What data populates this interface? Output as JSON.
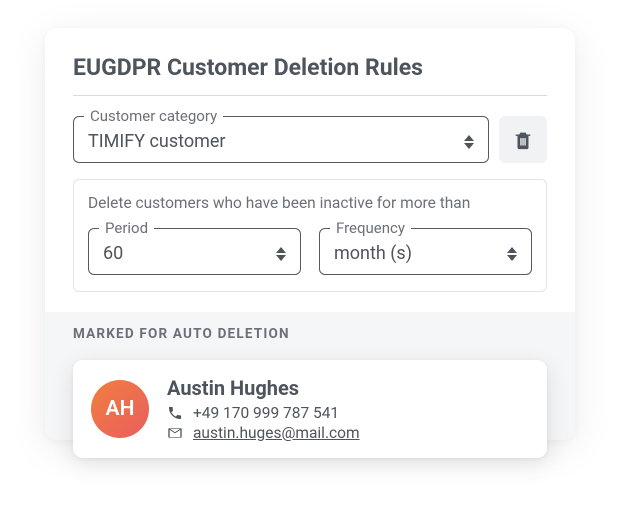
{
  "title": "EUGDPR Customer Deletion Rules",
  "category": {
    "label": "Customer category",
    "value": "TIMIFY customer"
  },
  "rule": {
    "description": "Delete customers who have been inactive for more than",
    "period": {
      "label": "Period",
      "value": "60"
    },
    "frequency": {
      "label": "Frequency",
      "value": "month (s)"
    }
  },
  "marked": {
    "label": "MARKED FOR AUTO DELETION",
    "contact": {
      "initials": "AH",
      "name": "Austin Hughes",
      "phone": "+49 170 999 787 541",
      "email": "austin.huges@mail.com"
    }
  }
}
